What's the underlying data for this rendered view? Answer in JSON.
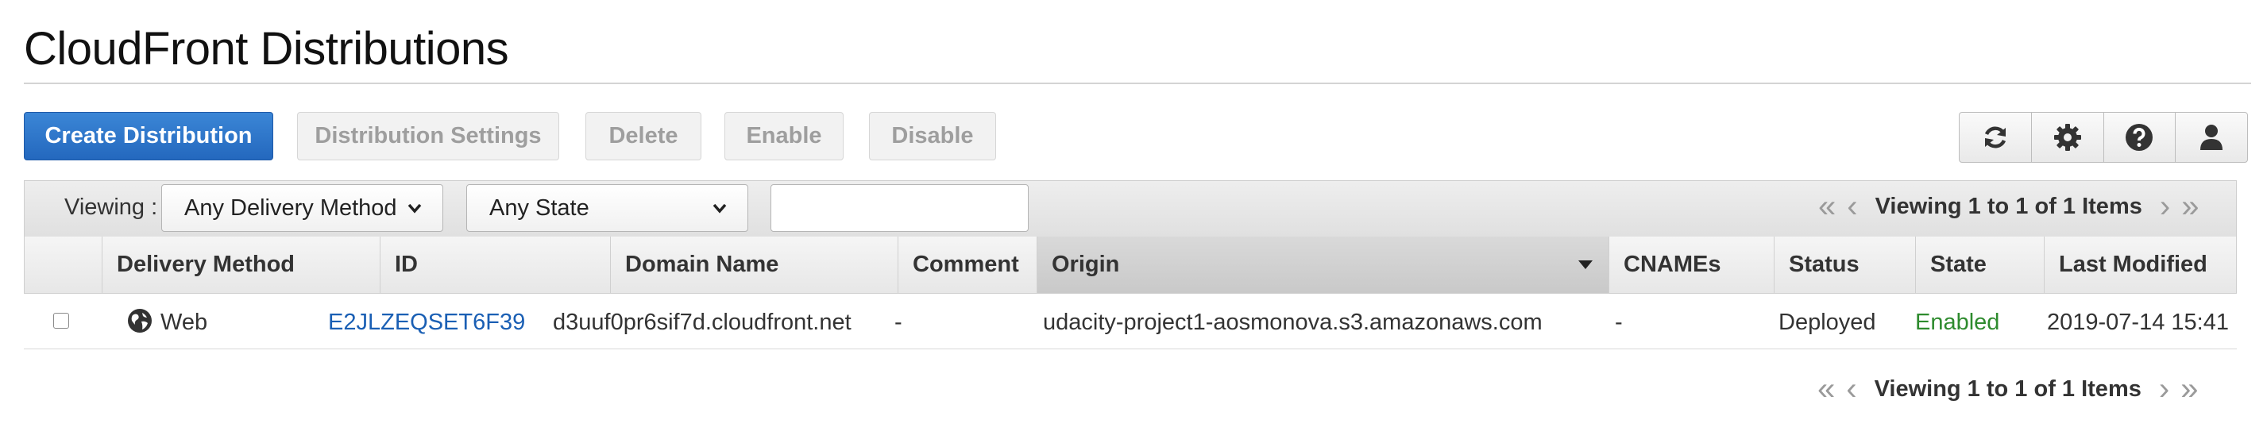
{
  "page": {
    "title": "CloudFront Distributions"
  },
  "toolbar": {
    "create_label": "Create Distribution",
    "settings_label": "Distribution Settings",
    "delete_label": "Delete",
    "enable_label": "Enable",
    "disable_label": "Disable",
    "icons": [
      "refresh-icon",
      "gear-icon",
      "help-icon",
      "user-icon"
    ]
  },
  "filter": {
    "viewing_label": "Viewing :",
    "delivery_method": "Any Delivery Method",
    "state": "Any State",
    "search_value": "",
    "pager_text": "Viewing 1 to 1 of 1 Items"
  },
  "table": {
    "columns": [
      "Delivery Method",
      "ID",
      "Domain Name",
      "Comment",
      "Origin",
      "CNAMEs",
      "Status",
      "State",
      "Last Modified"
    ],
    "sorted_column": "Origin",
    "rows": [
      {
        "delivery_method": "Web",
        "id": "E2JLZEQSET6F39",
        "domain_name": "d3uuf0pr6sif7d.cloudfront.net",
        "comment": "-",
        "origin": "udacity-project1-aosmonova.s3.amazonaws.com",
        "cnames": "-",
        "status": "Deployed",
        "state": "Enabled",
        "last_modified": "2019-07-14 15:41"
      }
    ]
  },
  "footer": {
    "pager_text": "Viewing 1 to 1 of 1 Items"
  },
  "colors": {
    "primary": "#2468be",
    "link": "#1a5fb4",
    "enabled": "#2e8b2e"
  }
}
